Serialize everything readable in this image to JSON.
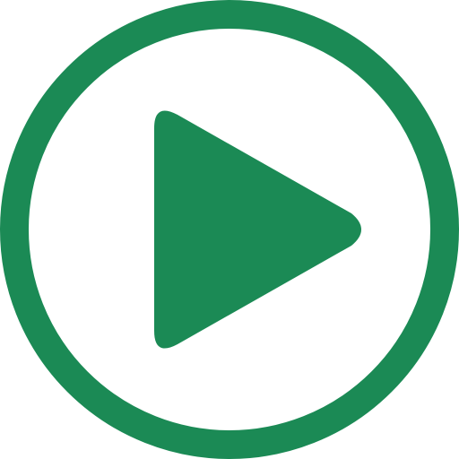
{
  "icon": {
    "name": "play-circle-icon",
    "accent_color": "#1B8A55",
    "background_color": "#FFFFFF"
  }
}
